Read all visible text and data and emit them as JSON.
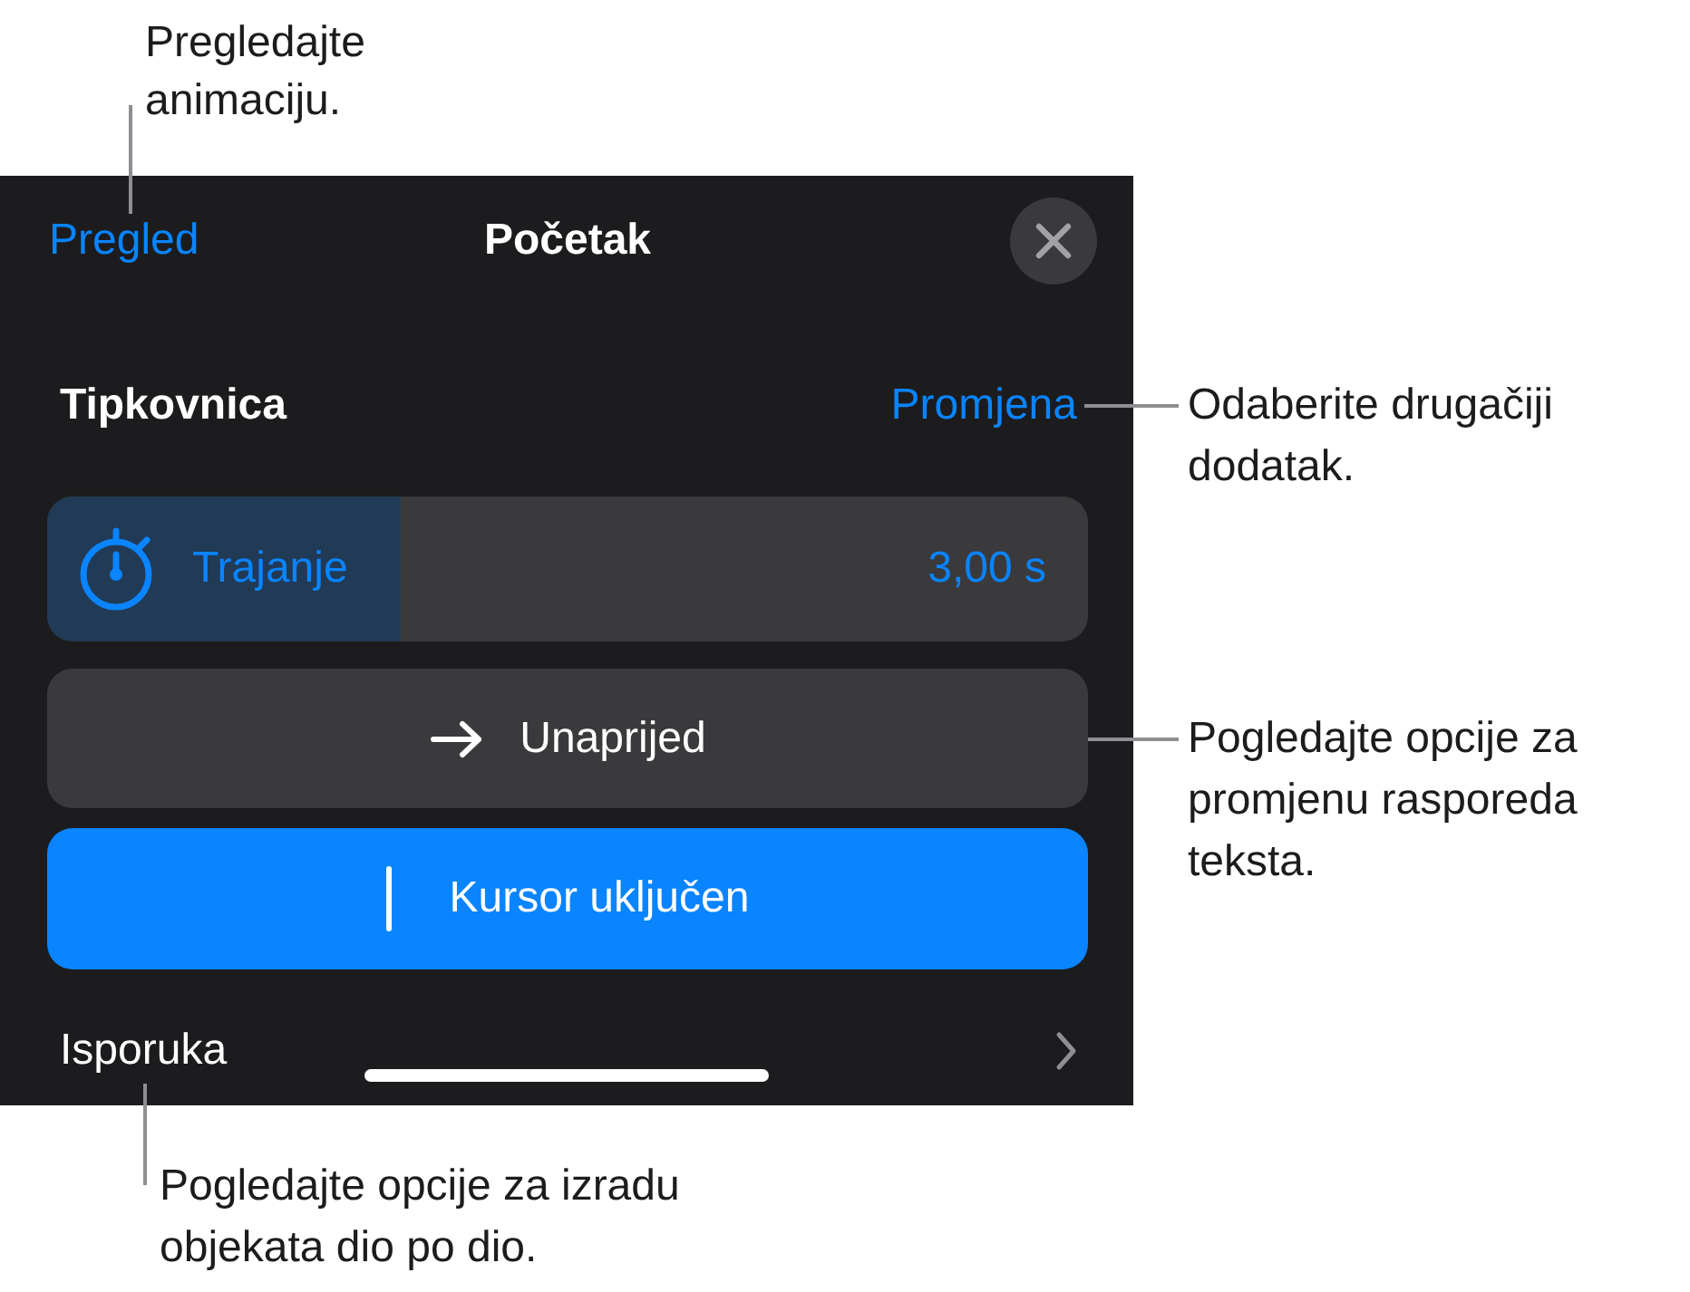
{
  "callouts": {
    "preview": "Pregledajte animaciju.",
    "change": "Odaberite drugačiji dodatak.",
    "direction": "Pogledajte opcije za promjenu rasporeda teksta.",
    "delivery": "Pogledajte opcije za izradu objekata dio po dio."
  },
  "panel": {
    "header": {
      "preview_button": "Pregled",
      "title": "Početak"
    },
    "effect": {
      "name": "Tipkovnica",
      "change_button": "Promjena"
    },
    "duration": {
      "label": "Trajanje",
      "value": "3,00 s",
      "level": 0.34
    },
    "direction_button": {
      "label": "Unaprijed"
    },
    "cursor_toggle": {
      "label": "Kursor uključen",
      "on": true
    },
    "delivery": {
      "label": "Isporuka"
    }
  }
}
